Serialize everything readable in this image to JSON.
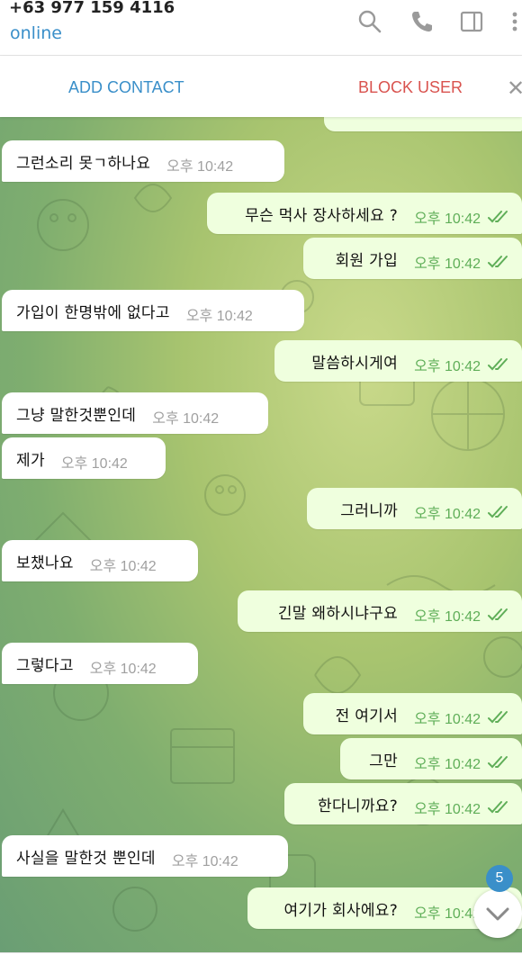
{
  "header": {
    "phone": "+63 977 159 4116",
    "status": "online",
    "icons": [
      "search-icon",
      "phone-icon",
      "sidebar-panel-icon",
      "more-vertical-icon"
    ]
  },
  "actions": {
    "add_contact": "ADD CONTACT",
    "block_user": "BLOCK USER",
    "close": "✕"
  },
  "colors": {
    "accent": "#3a8fc9",
    "block": "#d9534f",
    "outgoing_bubble": "#efffde",
    "incoming_bubble": "#ffffff",
    "tick": "#5fae58"
  },
  "messages": [
    {
      "dir": "in",
      "text": "그런소리 못ㄱ하나요",
      "time": "오후 10:42"
    },
    {
      "dir": "out",
      "text": "무슨 먹사 장사하세요 ?",
      "time": "오후 10:42",
      "read": true
    },
    {
      "dir": "out",
      "text": "회원 가입",
      "time": "오후 10:42",
      "read": true
    },
    {
      "dir": "in",
      "text": "가입이 한명밖에 없다고",
      "time": "오후 10:42"
    },
    {
      "dir": "out",
      "text": "말씀하시게여",
      "time": "오후 10:42",
      "read": true
    },
    {
      "dir": "in",
      "text": "그냥 말한것뿐인데",
      "time": "오후 10:42"
    },
    {
      "dir": "in",
      "text": "제가",
      "time": "오후 10:42"
    },
    {
      "dir": "out",
      "text": "그러니까",
      "time": "오후 10:42",
      "read": true
    },
    {
      "dir": "in",
      "text": "보챘나요",
      "time": "오후 10:42"
    },
    {
      "dir": "out",
      "text": "긴말 왜하시냐구요",
      "time": "오후 10:42",
      "read": true
    },
    {
      "dir": "in",
      "text": "그렇다고",
      "time": "오후 10:42"
    },
    {
      "dir": "out",
      "text": "전 여기서",
      "time": "오후 10:42",
      "read": true
    },
    {
      "dir": "out",
      "text": "그만",
      "time": "오후 10:42",
      "read": true
    },
    {
      "dir": "out",
      "text": "한다니까요?",
      "time": "오후 10:42",
      "read": true
    },
    {
      "dir": "in",
      "text": "사실을 말한것 뿐인데",
      "time": "오후 10:42"
    },
    {
      "dir": "out",
      "text": "여기가 회사에요?",
      "time": "오후 10:42",
      "read": true
    }
  ],
  "scroll_down": {
    "unread_count": "5"
  }
}
